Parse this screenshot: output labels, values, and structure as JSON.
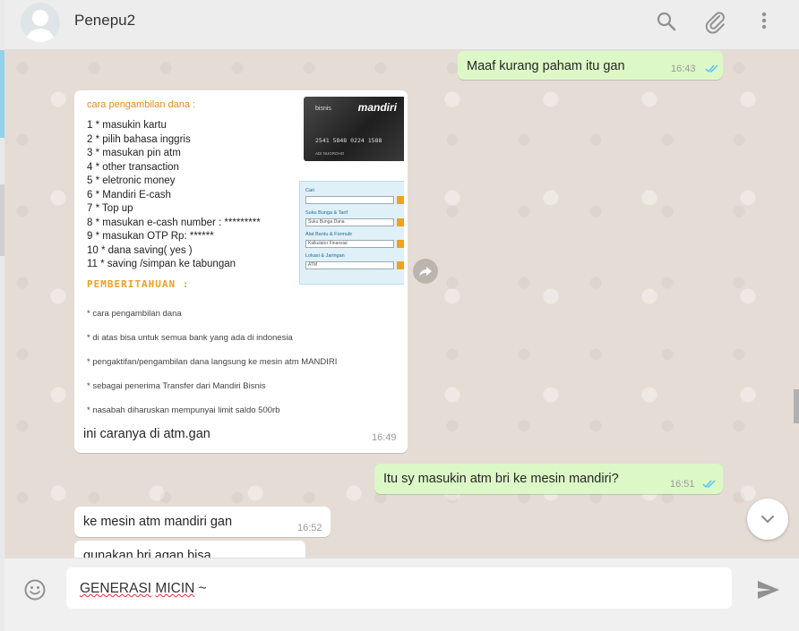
{
  "header": {
    "contact_name": "Penepu2",
    "icons": [
      "search-icon",
      "attach-icon",
      "menu-icon"
    ]
  },
  "messages": [
    {
      "id": "m1",
      "direction": "outgoing",
      "text": "Maaf kurang paham itu gan",
      "time": "16:43",
      "status": "read"
    },
    {
      "id": "m2",
      "direction": "incoming",
      "type": "image",
      "caption": "ini caranya di atm.gan",
      "time": "16:49"
    },
    {
      "id": "m3",
      "direction": "outgoing",
      "text": "Itu sy masukin atm bri ke mesin mandiri?",
      "time": "16:51",
      "status": "read"
    },
    {
      "id": "m4",
      "direction": "incoming",
      "text": "ke mesin atm mandiri gan",
      "time": "16:52"
    },
    {
      "id": "m5",
      "direction": "incoming",
      "text": "gunakan bri agan bisa"
    }
  ],
  "image_content": {
    "title": "cara pengambilan dana :",
    "steps": [
      "1  *  masukin kartu",
      "2  *  pilih bahasa inggris",
      "3  *  masukan pin atm",
      "4  *  other transaction",
      "5  *  eletronic money",
      "6  *  Mandiri E-cash",
      "7  *  Top up",
      "8  *  masukan e-cash number : *********",
      "9   *  masukan OTP Rp: ******",
      "10 *  dana saving( yes )",
      "11 *  saving /simpan ke tabungan"
    ],
    "notice_heading": "PEMBERITAHUAN :",
    "notes": [
      "*  cara pengambilan dana",
      "*  di atas bisa untuk semua bank yang ada di indonesia",
      "*  pengaktifan/pengambilan dana langsung ke mesin atm MANDIRI",
      "*  sebagai penerima Transfer dari Mandiri Bisnis",
      "*  nasabah diharuskan mempunyai limit saldo 500rb"
    ],
    "card": {
      "label": "bisnis",
      "brand": "mandiri",
      "number": "2541 5848 0224 1588",
      "name": "ADI NUGROHO"
    },
    "form": {
      "cari_label": "Cari",
      "suku_label": "Suku Bunga & Tarif",
      "suku_value": "Suku Bunga Dana",
      "alat_label": "Alat Bantu & Formulir",
      "alat_value": "Kalkulator Finansial",
      "lokasi_label": "Lokasi & Jaringan",
      "lokasi_value": "ATM",
      "button_label": "GO"
    }
  },
  "composer": {
    "text_word1": "GENERASI",
    "text_word2": "MICIN",
    "text_rest": " ~"
  },
  "colors": {
    "header_bg": "#ededed",
    "chat_bg": "#e5ddd5",
    "outgoing_bubble": "#dcf8c6",
    "incoming_bubble": "#ffffff",
    "read_ticks": "#4fc3f7"
  }
}
